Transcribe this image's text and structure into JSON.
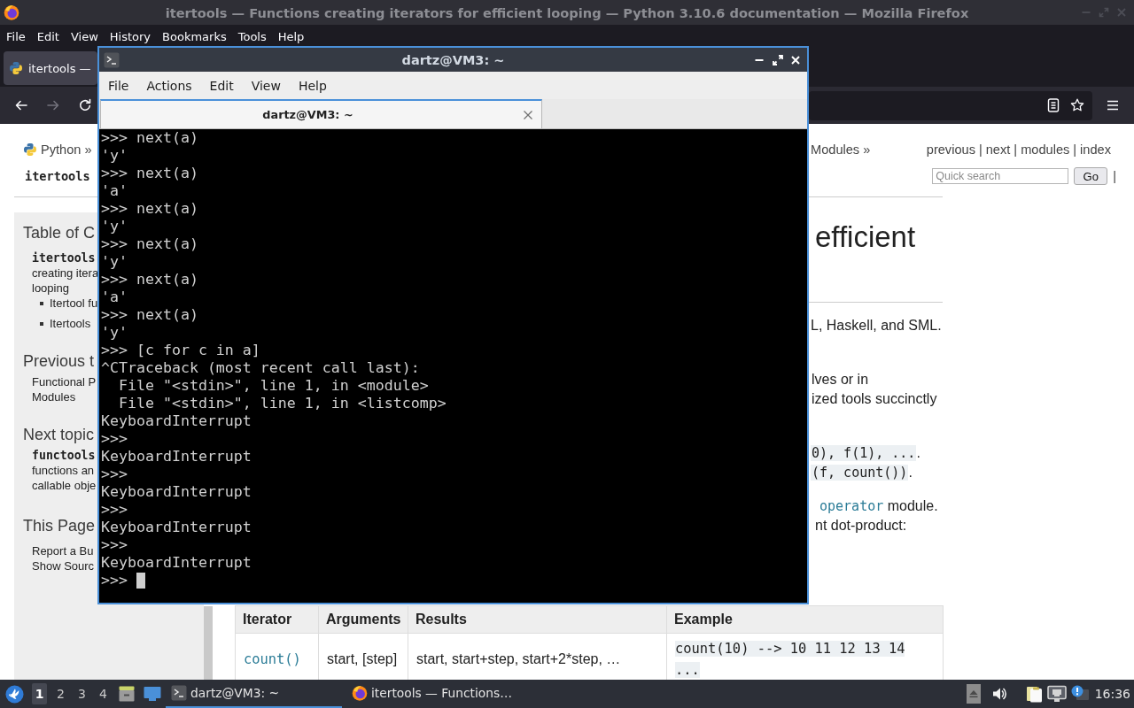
{
  "firefox": {
    "title": "itertools — Functions creating iterators for efficient looping — Python 3.10.6 documentation — Mozilla Firefox",
    "menu": [
      "File",
      "Edit",
      "View",
      "History",
      "Bookmarks",
      "Tools",
      "Help"
    ],
    "tabs": [
      {
        "label": "itertools —",
        "selected": true
      }
    ],
    "nav_buttons": [
      {
        "kind": "back",
        "disabled": false
      },
      {
        "kind": "forward",
        "disabled": true
      },
      {
        "kind": "reload",
        "disabled": false
      }
    ],
    "page": {
      "breadcrumb": [
        "Python »",
        "Modules »"
      ],
      "related_links": [
        "previous",
        "next",
        "modules",
        "index"
      ],
      "separator": "|",
      "module_title": "itertools",
      "search": {
        "placeholder": "Quick search",
        "button": "Go",
        "trailing": "|"
      },
      "sidebar": [
        {
          "heading": "Table of C",
          "lines": [
            {
              "kind": "code",
              "text": "itertools"
            },
            {
              "kind": "text",
              "text": "creating itera"
            },
            {
              "kind": "text",
              "text": "looping"
            },
            {
              "kind": "bullet",
              "text": "Itertool fu"
            },
            {
              "kind": "bullet",
              "text": "Itertools"
            }
          ]
        },
        {
          "heading": "Previous t",
          "lines": [
            {
              "kind": "text",
              "text": "Functional P"
            },
            {
              "kind": "text",
              "text": "Modules"
            }
          ]
        },
        {
          "heading": "Next topic",
          "lines": [
            {
              "kind": "code",
              "text": "functools"
            },
            {
              "kind": "text",
              "text": "functions an"
            },
            {
              "kind": "text",
              "text": "callable obje"
            }
          ]
        },
        {
          "heading": "This Page",
          "lines": [
            {
              "kind": "text",
              "text": "Report a Bu"
            },
            {
              "kind": "text",
              "text": "Show Sourc"
            }
          ]
        }
      ],
      "heading": "efficient",
      "paragraphs": [
        [
          [
            {
              "kind": "text",
              "text": "L, Haskell, and SML."
            }
          ]
        ],
        [
          [
            {
              "kind": "text",
              "text": "lves or in"
            }
          ],
          [
            {
              "kind": "text",
              "text": "ized tools succinctly"
            }
          ]
        ],
        [
          [
            {
              "kind": "code",
              "text": "0), f(1), ..."
            },
            {
              "kind": "text",
              "text": "."
            }
          ],
          [
            {
              "kind": "code",
              "text": "(f, count())"
            },
            {
              "kind": "text",
              "text": "."
            }
          ]
        ],
        [
          [
            {
              "kind": "link",
              "text": "operator"
            },
            {
              "kind": "text",
              "text": " module."
            }
          ],
          [
            {
              "kind": "text",
              "text": "nt dot-product:"
            }
          ]
        ]
      ],
      "table": {
        "columns": [
          "Iterator",
          "Arguments",
          "Results",
          "Example"
        ],
        "rows": [
          [
            {
              "kind": "link",
              "text": "count()"
            },
            {
              "kind": "text",
              "text": "start, [step]"
            },
            {
              "kind": "text",
              "text": "start, start+step, start+2*step, …"
            },
            {
              "kind": "code",
              "text": "count(10) --> 10 11 12 13 14 ..."
            }
          ]
        ]
      }
    }
  },
  "terminal": {
    "title": "dartz@VM3: ~",
    "menu": [
      "File",
      "Actions",
      "Edit",
      "View",
      "Help"
    ],
    "tabs": [
      {
        "label": "dartz@VM3: ~",
        "selected": true
      }
    ],
    "lines": [
      ">>> next(a)",
      "'y'",
      ">>> next(a)",
      "'a'",
      ">>> next(a)",
      "'y'",
      ">>> next(a)",
      "'y'",
      ">>> next(a)",
      "'a'",
      ">>> next(a)",
      "'y'",
      ">>> [c for c in a]",
      "^CTraceback (most recent call last):",
      "  File \"<stdin>\", line 1, in <module>",
      "  File \"<stdin>\", line 1, in <listcomp>",
      "KeyboardInterrupt",
      ">>>",
      "KeyboardInterrupt",
      ">>>",
      "KeyboardInterrupt",
      ">>>",
      "KeyboardInterrupt",
      ">>>",
      "KeyboardInterrupt",
      ">>>"
    ],
    "cursor": true
  },
  "taskbar": {
    "workspaces": [
      {
        "label": "1",
        "selected": true
      },
      {
        "label": "2",
        "selected": false
      },
      {
        "label": "3",
        "selected": false
      },
      {
        "label": "4",
        "selected": false
      }
    ],
    "tasks": [
      {
        "kind": "terminal",
        "label": "dartz@VM3: ~",
        "selected": true
      },
      {
        "kind": "browser",
        "label": "itertools — Functions…",
        "selected": false
      }
    ],
    "clock": "16:36"
  }
}
